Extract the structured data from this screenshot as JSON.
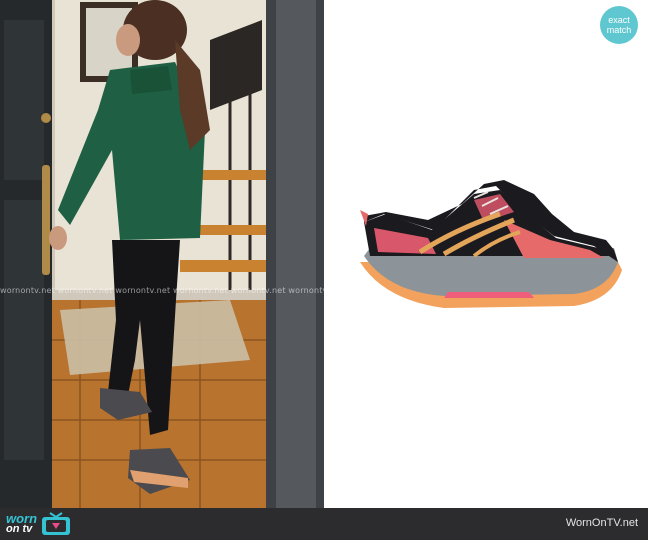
{
  "watermark": {
    "text": "wornontv.net",
    "repeat_line": "wornontv.net  wornontv.net  wornontv.net  wornontv.net  wornontv.net  wornontv.net  wornontv.net"
  },
  "badge": {
    "line1": "exact",
    "line2": "match"
  },
  "footer": {
    "logo_top": "worn",
    "logo_bottom": "on tv",
    "site": "WornOnTV.net"
  },
  "colors": {
    "accent": "#35c3d4",
    "badge": "#5ec7d0",
    "footer_bg": "#2c2c2e",
    "jacket": "#1f5f43",
    "shoe_upper": "#1b1a1f",
    "shoe_accent": "#e66a6a",
    "sole": "#f2a25c"
  },
  "icons": {
    "footer_logo": "tv-icon"
  }
}
